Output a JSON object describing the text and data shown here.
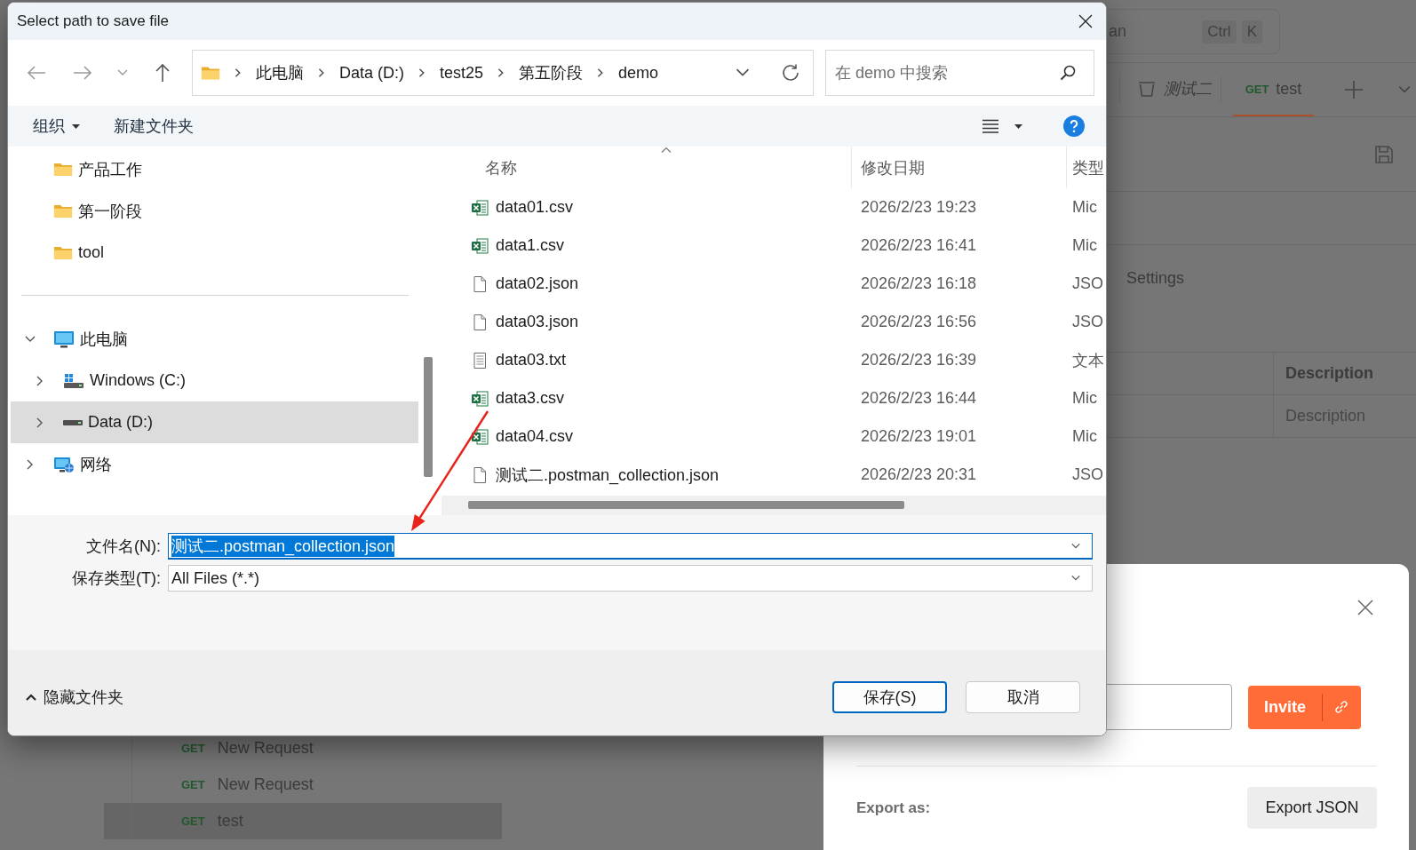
{
  "background_app": {
    "search": {
      "placeholder": "an",
      "shortcut_keys": [
        "Ctrl",
        "K"
      ]
    },
    "tabs": [
      {
        "kind": "collection",
        "label": "测试二",
        "selected": false
      },
      {
        "kind": "request",
        "method": "GET",
        "label": "test",
        "selected": true
      }
    ],
    "settings_label": "Settings",
    "table": {
      "columns": [
        "Description"
      ],
      "rows": [
        {
          "placeholder": "Description"
        }
      ]
    },
    "sidebar_requests": [
      {
        "method": "GET",
        "name": "New Request",
        "selected": false
      },
      {
        "method": "GET",
        "name": "New Request",
        "selected": false
      },
      {
        "method": "GET",
        "name": "test",
        "selected": true
      }
    ]
  },
  "share_modal": {
    "invite_button": "Invite",
    "export_label": "Export as:",
    "export_button": "Export JSON"
  },
  "save_dialog": {
    "title": "Select path to save file",
    "breadcrumb": [
      "此电脑",
      "Data (D:)",
      "test25",
      "第五阶段",
      "demo"
    ],
    "search": {
      "placeholder": "在 demo 中搜索"
    },
    "toolbar": {
      "organize": "组织",
      "new_folder": "新建文件夹"
    },
    "quick_access": [
      {
        "label": "产品工作",
        "selected": false
      },
      {
        "label": "第一阶段",
        "selected": false
      },
      {
        "label": "tool",
        "selected": false
      }
    ],
    "tree": [
      {
        "kind": "computer",
        "label": "此电脑",
        "expanded": true,
        "selected": false,
        "children": [
          {
            "kind": "system-drive",
            "label": "Windows (C:)",
            "expanded": false,
            "selected": false
          },
          {
            "kind": "drive",
            "label": "Data (D:)",
            "expanded": false,
            "selected": true
          }
        ]
      },
      {
        "kind": "network",
        "label": "网络",
        "expanded": false,
        "selected": false
      }
    ],
    "columns": [
      {
        "label": "名称",
        "sorted": true
      },
      {
        "label": "修改日期",
        "sorted": false
      },
      {
        "label": "类型",
        "sorted": false
      }
    ],
    "files": [
      {
        "kind": "excel",
        "name": "data01.csv",
        "modified": "2026/2/23 19:23",
        "type": "Mic",
        "selected": false
      },
      {
        "kind": "excel",
        "name": "data1.csv",
        "modified": "2026/2/23 16:41",
        "type": "Mic",
        "selected": false
      },
      {
        "kind": "json",
        "name": "data02.json",
        "modified": "2026/2/23 16:18",
        "type": "JSO",
        "selected": false
      },
      {
        "kind": "json",
        "name": "data03.json",
        "modified": "2026/2/23 16:56",
        "type": "JSO",
        "selected": false
      },
      {
        "kind": "text",
        "name": "data03.txt",
        "modified": "2026/2/23 16:39",
        "type": "文本",
        "selected": false
      },
      {
        "kind": "excel",
        "name": "data3.csv",
        "modified": "2026/2/23 16:44",
        "type": "Mic",
        "selected": false
      },
      {
        "kind": "excel",
        "name": "data04.csv",
        "modified": "2026/2/23 19:01",
        "type": "Mic",
        "selected": false
      },
      {
        "kind": "json",
        "name": "测试二.postman_collection.json",
        "modified": "2026/2/23 20:31",
        "type": "JSO",
        "selected": false
      }
    ],
    "file_name": {
      "label": "文件名(N):",
      "value": "测试二.postman_collection.json",
      "text_selected": true
    },
    "file_type": {
      "label": "保存类型(T):",
      "value": "All Files (*.*)"
    },
    "hide_folders": "隐藏文件夹",
    "buttons": [
      {
        "label": "保存(S)",
        "default": true
      },
      {
        "label": "取消",
        "default": false
      }
    ]
  }
}
